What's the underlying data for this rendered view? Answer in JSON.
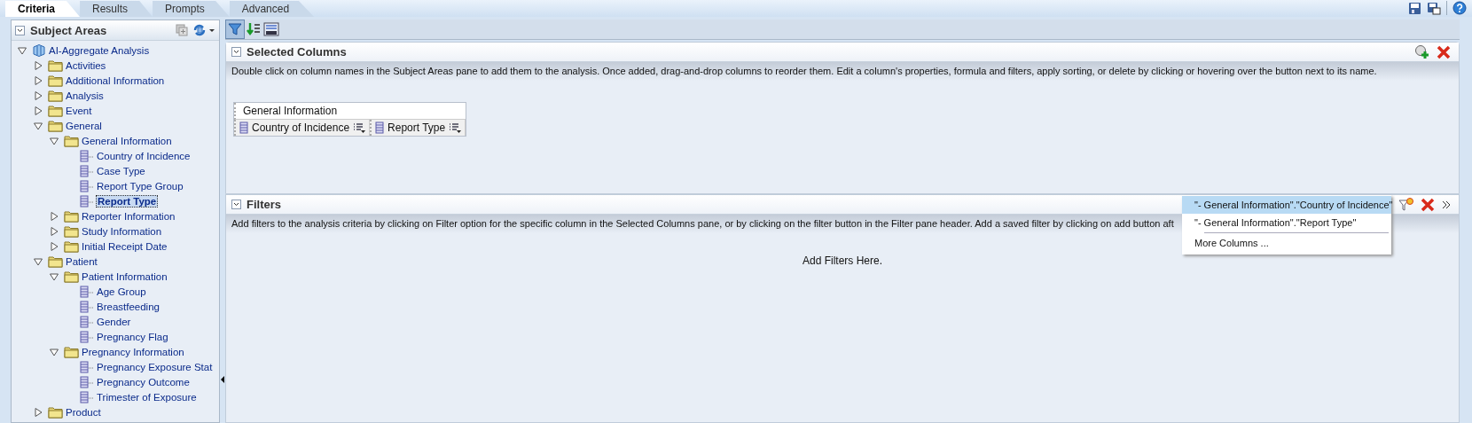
{
  "tabs": [
    {
      "label": "Criteria",
      "selected": true
    },
    {
      "label": "Results",
      "selected": false
    },
    {
      "label": "Prompts",
      "selected": false
    },
    {
      "label": "Advanced",
      "selected": false
    }
  ],
  "subject_areas": {
    "title": "Subject Areas",
    "tree": [
      {
        "label": "AI-Aggregate Analysis",
        "kind": "area",
        "expanded": true,
        "selected": false,
        "children": [
          {
            "label": "Activities",
            "kind": "folder",
            "expanded": false,
            "selected": false
          },
          {
            "label": "Additional Information",
            "kind": "folder",
            "expanded": false,
            "selected": false
          },
          {
            "label": "Analysis",
            "kind": "folder",
            "expanded": false,
            "selected": false
          },
          {
            "label": "Event",
            "kind": "folder",
            "expanded": false,
            "selected": false
          },
          {
            "label": "General",
            "kind": "folder",
            "expanded": true,
            "selected": false,
            "children": [
              {
                "label": "General Information",
                "kind": "folder",
                "expanded": true,
                "selected": false,
                "children": [
                  {
                    "label": "Country of Incidence",
                    "kind": "column",
                    "selected": false
                  },
                  {
                    "label": "Case Type",
                    "kind": "column",
                    "selected": false
                  },
                  {
                    "label": "Report Type Group",
                    "kind": "column",
                    "selected": false
                  },
                  {
                    "label": "Report Type",
                    "kind": "column",
                    "selected": true
                  }
                ]
              },
              {
                "label": "Reporter Information",
                "kind": "folder",
                "expanded": false,
                "selected": false
              },
              {
                "label": "Study Information",
                "kind": "folder",
                "expanded": false,
                "selected": false
              },
              {
                "label": "Initial Receipt Date",
                "kind": "folder",
                "expanded": false,
                "selected": false
              }
            ]
          },
          {
            "label": "Patient",
            "kind": "folder",
            "expanded": true,
            "selected": false,
            "children": [
              {
                "label": "Patient Information",
                "kind": "folder",
                "expanded": true,
                "selected": false,
                "children": [
                  {
                    "label": "Age Group",
                    "kind": "column",
                    "selected": false
                  },
                  {
                    "label": "Breastfeeding",
                    "kind": "column",
                    "selected": false
                  },
                  {
                    "label": "Gender",
                    "kind": "column",
                    "selected": false
                  },
                  {
                    "label": "Pregnancy Flag",
                    "kind": "column",
                    "selected": false
                  }
                ]
              },
              {
                "label": "Pregnancy Information",
                "kind": "folder",
                "expanded": true,
                "selected": false,
                "children": [
                  {
                    "label": "Pregnancy Exposure Stat",
                    "kind": "column",
                    "selected": false
                  },
                  {
                    "label": "Pregnancy Outcome",
                    "kind": "column",
                    "selected": false
                  },
                  {
                    "label": "Trimester of Exposure",
                    "kind": "column",
                    "selected": false
                  }
                ]
              }
            ]
          },
          {
            "label": "Product",
            "kind": "folder",
            "expanded": false,
            "selected": false
          }
        ]
      }
    ]
  },
  "selected_columns": {
    "title": "Selected Columns",
    "description": "Double click on column names in the Subject Areas pane to add them to the analysis. Once added, drag-and-drop columns to reorder them. Edit a column's properties, formula and filters, apply sorting, or delete by clicking or hovering over the button next to its name.",
    "group": "General Information",
    "columns": [
      "Country of Incidence",
      "Report Type"
    ]
  },
  "filters": {
    "title": "Filters",
    "description": "Add filters to the analysis criteria by clicking on Filter option for the specific column in the Selected Columns pane, or by clicking on the filter button in the Filter pane header. Add a saved filter by clicking on add button aft",
    "empty": "Add Filters Here."
  },
  "filter_menu": {
    "items": [
      {
        "label": "\"- General Information\".\"Country of Incidence\"",
        "selected": true
      },
      {
        "label": "\"- General Information\".\"Report Type\"",
        "selected": false
      }
    ],
    "more": "More Columns ..."
  }
}
